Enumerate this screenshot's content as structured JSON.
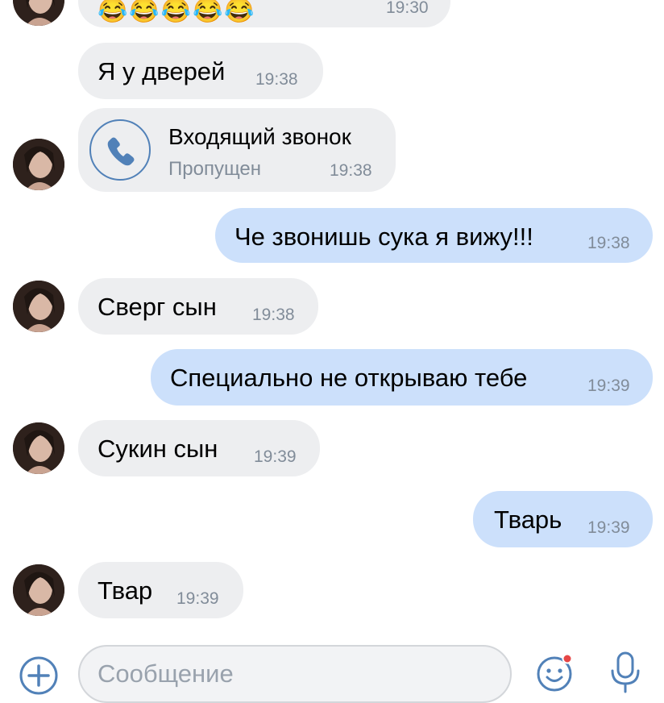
{
  "messages": [
    {
      "id": "m0",
      "direction": "in",
      "emoji": "😂😂😂😂😂",
      "time": "19:30"
    },
    {
      "id": "m1",
      "direction": "in",
      "text": "Я у дверей",
      "time": "19:38"
    },
    {
      "id": "m2",
      "direction": "in",
      "type": "call",
      "call_title": "Входящий звонок",
      "call_status": "Пропущен",
      "time": "19:38"
    },
    {
      "id": "m3",
      "direction": "out",
      "text": "Че звонишь сука я вижу!!!",
      "time": "19:38"
    },
    {
      "id": "m4",
      "direction": "in",
      "text": "Сверг сын",
      "time": "19:38"
    },
    {
      "id": "m5",
      "direction": "out",
      "text": "Специально не открываю тебе",
      "time": "19:39"
    },
    {
      "id": "m6",
      "direction": "in",
      "text": "Сукин сын",
      "time": "19:39"
    },
    {
      "id": "m7",
      "direction": "out",
      "text": "Тварь",
      "time": "19:39"
    },
    {
      "id": "m8",
      "direction": "in",
      "text": "Твар",
      "time": "19:39"
    }
  ],
  "composer": {
    "placeholder": "Сообщение",
    "add_icon": "plus-circle-icon",
    "emoji_icon": "smiley-icon",
    "mic_icon": "microphone-icon"
  },
  "colors": {
    "incoming_bubble": "#edeef0",
    "outgoing_bubble": "#cce0fb",
    "accent": "#5181b8",
    "time_text": "#818c99",
    "notification_dot": "#e64646"
  }
}
